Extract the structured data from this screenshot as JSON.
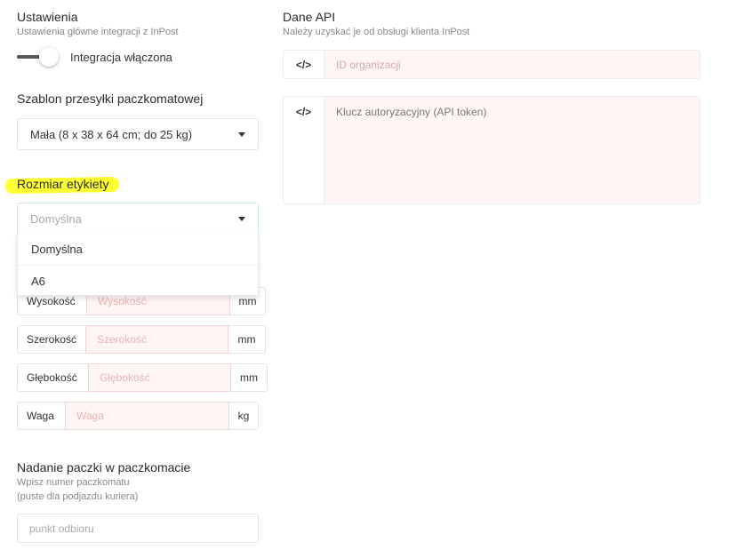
{
  "settings": {
    "title": "Ustawienia",
    "subtitle": "Ustawienia główne integracji z InPost",
    "toggle_label": "Integracja włączona"
  },
  "template": {
    "title": "Szablon przesyłki paczkomatowej",
    "selected": "Mała (8 x 38 x 64 cm; do 25 kg)"
  },
  "label_size": {
    "title": "Rozmiar etykiety",
    "placeholder": "Domyślna",
    "options": [
      "Domyślna",
      "A6"
    ]
  },
  "dimensions": {
    "height": {
      "label": "Wysokość",
      "placeholder": "Wysokość",
      "unit": "mm"
    },
    "width": {
      "label": "Szerokość",
      "placeholder": "Szerokość",
      "unit": "mm"
    },
    "depth": {
      "label": "Głębokość",
      "placeholder": "Głębokość",
      "unit": "mm"
    },
    "weight": {
      "label": "Waga",
      "placeholder": "Waga",
      "unit": "kg"
    }
  },
  "dropoff": {
    "title": "Nadanie paczki w paczkomacie",
    "subtitle_line1": "Wpisz numer paczkomatu",
    "subtitle_line2": "(puste dla podjazdu kuriera)",
    "placeholder": "punkt odbioru"
  },
  "api": {
    "title": "Dane API",
    "subtitle": "Należy uzyskać je od obsługi klienta InPost",
    "org_id_placeholder": "ID organizacji",
    "token_placeholder": "Klucz autoryzacyjny (API token)",
    "code_icon_glyph": "</>"
  },
  "colors": {
    "highlight": "#ffff33",
    "invalid_field_bg": "#fff5f5"
  }
}
